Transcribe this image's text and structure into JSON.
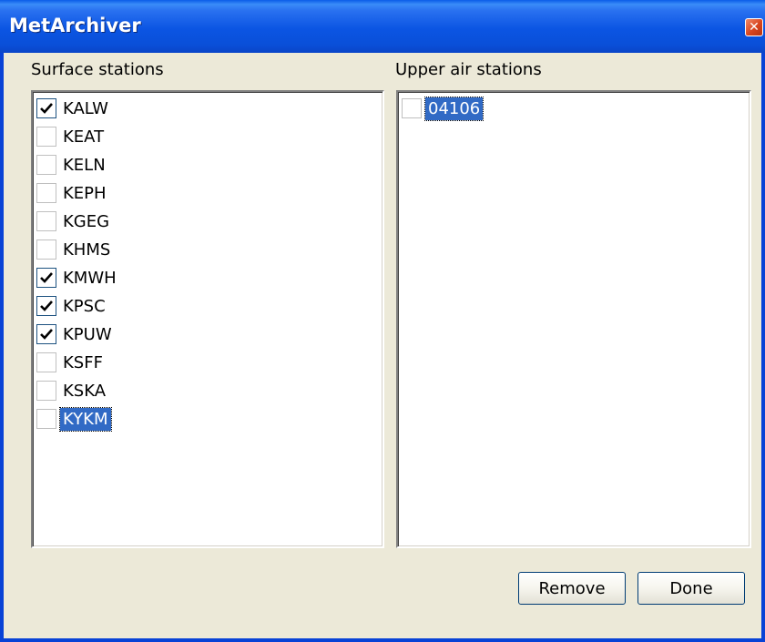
{
  "window": {
    "title": "MetArchiver",
    "close_glyph": "✕",
    "close_icon": "close-icon"
  },
  "surface": {
    "label": "Surface stations",
    "items": [
      {
        "label": "KALW",
        "checked": true
      },
      {
        "label": "KEAT",
        "checked": false
      },
      {
        "label": "KELN",
        "checked": false
      },
      {
        "label": "KEPH",
        "checked": false
      },
      {
        "label": "KGEG",
        "checked": false
      },
      {
        "label": "KHMS",
        "checked": false
      },
      {
        "label": "KMWH",
        "checked": true
      },
      {
        "label": "KPSC",
        "checked": true
      },
      {
        "label": "KPUW",
        "checked": true
      },
      {
        "label": "KSFF",
        "checked": false
      },
      {
        "label": "KSKA",
        "checked": false
      },
      {
        "label": "KYKM",
        "checked": false,
        "selected": true
      }
    ]
  },
  "upper": {
    "label": "Upper air stations",
    "items": [
      {
        "label": "04106",
        "checked": false,
        "selected": true
      }
    ]
  },
  "buttons": {
    "remove": "Remove",
    "done": "Done"
  },
  "colors": {
    "titlebar": "#0b55e3",
    "selection": "#316ac5",
    "dialog_bg": "#ece9d8",
    "close_button": "#d8451f"
  }
}
